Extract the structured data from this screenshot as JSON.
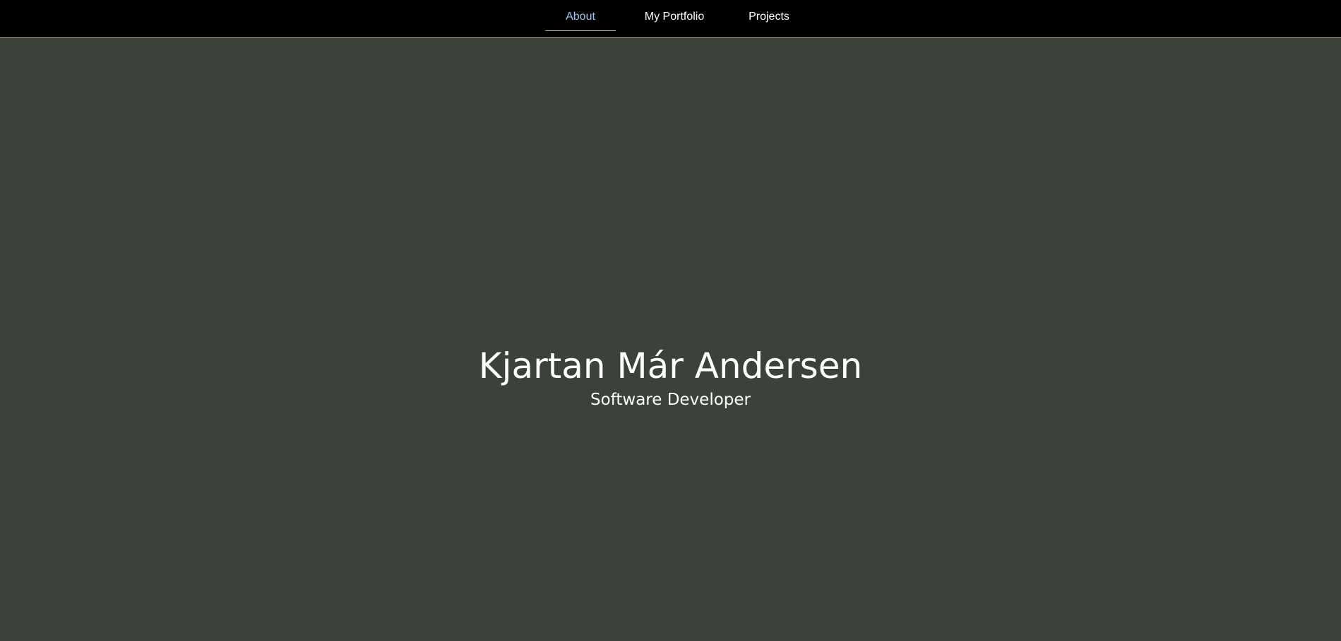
{
  "nav": {
    "items": [
      {
        "label": "About",
        "active": true
      },
      {
        "label": "My Portfolio",
        "active": false
      },
      {
        "label": "Projects",
        "active": false
      }
    ]
  },
  "hero": {
    "name": "Kjartan Már Andersen",
    "role": "Software Developer"
  },
  "colors": {
    "background": "#3b423a",
    "navbar": "#000000",
    "accent_line": "#b89a5e",
    "active_link": "#9cc7ef",
    "text": "#ffffff"
  }
}
